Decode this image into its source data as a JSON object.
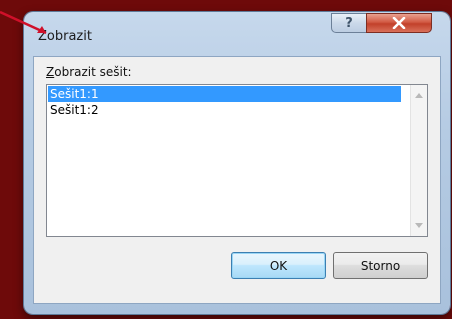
{
  "dialog": {
    "title": "Zobrazit",
    "help_glyph": "?",
    "close_glyph": "x",
    "icons": {
      "help": "question-mark-icon",
      "close": "close-x-icon",
      "scroll_up": "scroll-up-arrow-icon",
      "scroll_down": "scroll-down-arrow-icon"
    },
    "list_label_prefix": "Z",
    "list_label_rest": "obrazit sešit:",
    "items": [
      {
        "label": "Sešit1:1",
        "selected": true
      },
      {
        "label": "Sešit1:2",
        "selected": false
      }
    ],
    "ok_label": "OK",
    "cancel_label": "Storno"
  },
  "colors": {
    "background": "#6e0a0a",
    "selection": "#3399ff",
    "close_button": "#c2402a",
    "callout_line": "#d0102a"
  }
}
